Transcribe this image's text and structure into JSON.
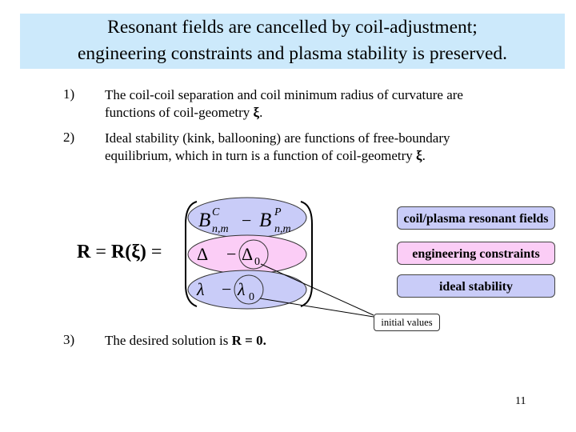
{
  "title": {
    "line1": "Resonant fields are cancelled by coil-adjustment;",
    "line2": "engineering constraints and plasma stability is preserved."
  },
  "items": [
    {
      "number": "1)",
      "line1": "The coil-coil separation and coil minimum radius of curvature are",
      "line2_prefix": "functions of coil-geometry ",
      "symbol": "ξ",
      "line2_suffix": "."
    },
    {
      "number": "2)",
      "line1": "Ideal stability (kink, ballooning) are functions of free-boundary",
      "line2_prefix": "equilibrium, which in turn is a function of coil-geometry ",
      "symbol": "ξ",
      "line2_suffix": "."
    },
    {
      "number": "3)",
      "prefix": "The desired solution is ",
      "bold": "R = 0."
    }
  ],
  "equation": {
    "lhs": "R",
    "equals1": " = ",
    "func": "R(ξ)",
    "equals2": " =",
    "rows": [
      {
        "a": "B",
        "a_sup": "C",
        "a_sub": "n,m",
        "op": "−",
        "b": "B",
        "b_sup": "P",
        "b_sub": "n,m"
      },
      {
        "a": "Δ",
        "op": "−",
        "b": "Δ",
        "b_sub": "0"
      },
      {
        "a": "λ",
        "op": "−",
        "b": "λ",
        "b_sub": "0"
      }
    ]
  },
  "labels": {
    "resonant": "coil/plasma resonant fields",
    "engineering": "engineering constraints",
    "stability": "ideal stability",
    "initial": "initial values"
  },
  "colors": {
    "title_bg": "#cce9fb",
    "blue": "#c9ccf8",
    "pink": "#fbcdf6"
  },
  "page_number": "11"
}
